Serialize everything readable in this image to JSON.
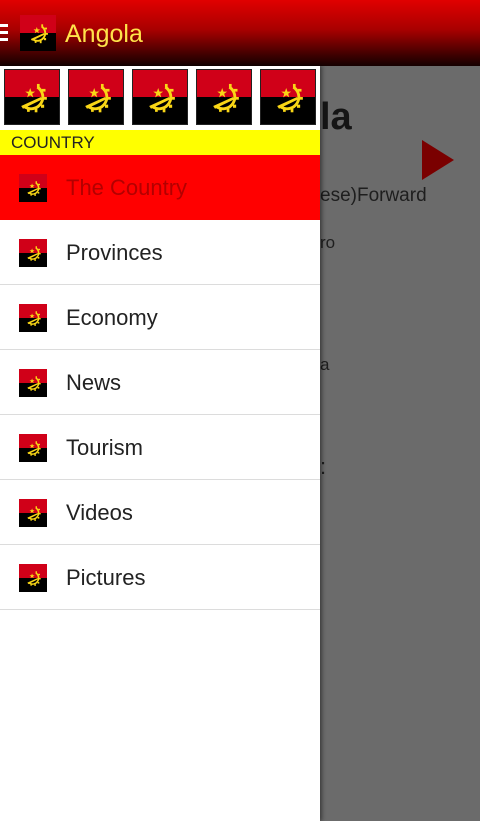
{
  "app": {
    "title": "Angola",
    "menu_icon": "hamburger-menu-icon",
    "logo_icon": "angola-flag-icon"
  },
  "colors": {
    "flag_red": "#d00018",
    "flag_black": "#000000",
    "emblem_yellow": "#f9d616",
    "title_yellow": "#ffe34a",
    "section_header_bg": "#ffff00",
    "active_item_bg": "#ff0000",
    "active_item_text": "#b30000"
  },
  "background_content": {
    "title_fragment": "la",
    "line_1": "ese)Forward",
    "line_2": "ro",
    "line_3": "a",
    "line_4": ":",
    "play_icon": "play-icon"
  },
  "drawer": {
    "flag_strip_count": 5,
    "section_header": "COUNTRY",
    "items": [
      {
        "label": "The Country",
        "active": true
      },
      {
        "label": "Provinces",
        "active": false
      },
      {
        "label": "Economy",
        "active": false
      },
      {
        "label": "News",
        "active": false
      },
      {
        "label": "Tourism",
        "active": false
      },
      {
        "label": "Videos",
        "active": false
      },
      {
        "label": "Pictures",
        "active": false
      }
    ]
  }
}
